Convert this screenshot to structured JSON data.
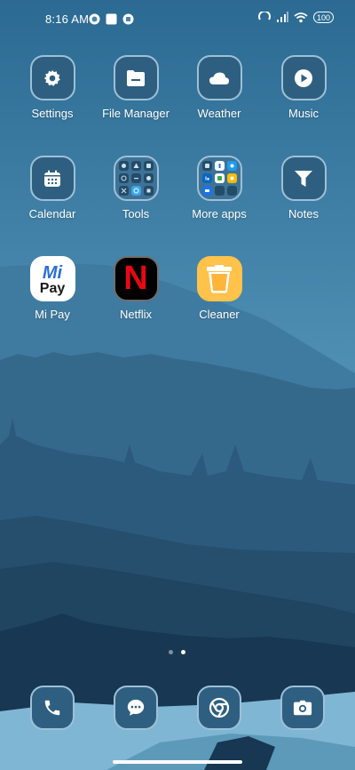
{
  "status": {
    "time": "8:16 AM",
    "battery": "100"
  },
  "apps": [
    {
      "id": "settings",
      "label": "Settings"
    },
    {
      "id": "file-manager",
      "label": "File Manager"
    },
    {
      "id": "weather",
      "label": "Weather"
    },
    {
      "id": "music",
      "label": "Music"
    },
    {
      "id": "calendar",
      "label": "Calendar"
    },
    {
      "id": "tools",
      "label": "Tools"
    },
    {
      "id": "more-apps",
      "label": "More apps"
    },
    {
      "id": "notes",
      "label": "Notes"
    },
    {
      "id": "mi-pay",
      "label": "Mi Pay"
    },
    {
      "id": "netflix",
      "label": "Netflix"
    },
    {
      "id": "cleaner",
      "label": "Cleaner"
    }
  ],
  "mipay_text": {
    "mi": "Mi",
    "pay": "Pay"
  },
  "netflix_letter": "N",
  "dock": [
    "phone-icon",
    "messages-icon",
    "chrome-icon",
    "camera-icon"
  ],
  "colors": {
    "sky": "#4a86ab",
    "icon_bg": "#2f5f80",
    "icon_border": "#9ec0d8",
    "netflix_red": "#e50914",
    "cleaner_orange": "#ffb43a"
  }
}
